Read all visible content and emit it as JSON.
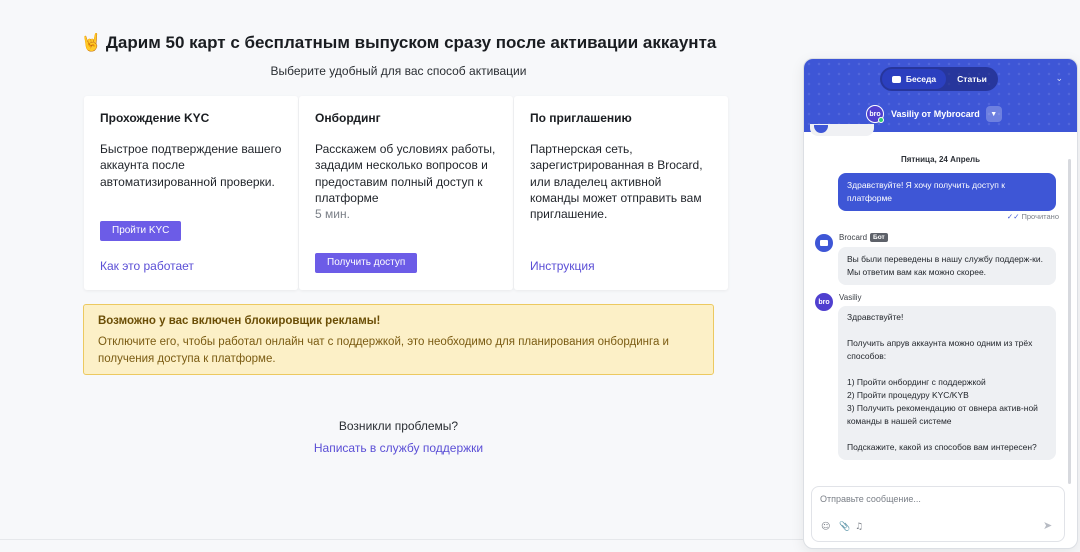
{
  "main": {
    "headline_emoji": "🤘",
    "headline": "Дарим 50 карт с бесплатным выпуском сразу после активации аккаунта",
    "subheadline": "Выберите удобный для вас способ активации",
    "cards": [
      {
        "title": "Прохождение KYC",
        "body": "Быстрое подтверждение вашего аккаунта после автоматизированной проверки.",
        "button": "Пройти KYC",
        "link": "Как это работает"
      },
      {
        "title": "Онбординг",
        "body": "Расскажем об условиях работы, зададим несколько вопросов и предоставим полный доступ к платформе",
        "body_muted": "5 мин.",
        "button": "Получить доступ"
      },
      {
        "title": "По приглашению",
        "body": "Партнерская сеть, зарегистрированная в Brocard, или владелец активной команды может отправить вам приглашение.",
        "link": "Инструкция"
      }
    ],
    "adblock": {
      "title": "Возможно у вас включен блокировщик рекламы!",
      "text": "Отключите его, чтобы работал онлайн чат с поддержкой, это необходимо для планирования онбординга и получения доступа к платформе."
    },
    "problems_label": "Возникли проблемы?",
    "support_link": "Написать в службу поддержки"
  },
  "chat": {
    "tabs": [
      "Беседа",
      "Статьи"
    ],
    "active_tab": 0,
    "agent_avatar": "bro",
    "agent_name": "Vasiliy от Mybrocard",
    "date_separator": "Пятница, 24 Апрель",
    "messages": [
      {
        "side": "out",
        "text": "Здравствуйте! Я хочу получить доступ к платформе",
        "status": "Прочитано"
      },
      {
        "side": "in",
        "sender": "Brocard",
        "badge": "Бот",
        "text": "Вы были переведены в нашу службу поддерж-ки. Мы ответим вам как можно скорее."
      },
      {
        "side": "in",
        "sender": "Vasiliy",
        "avatar": "bro",
        "lines": [
          "Здравствуйте!",
          "",
          "Получить апрув аккаунта можно одним из трёх способов:",
          "",
          "1) Пройти онбординг с поддержкой",
          "2) Пройти процедуру KYC/KYB",
          "3) Получить рекомендацию от овнера актив-ной команды в нашей системе",
          "",
          "Подскажите, какой из способов вам интересен?"
        ]
      }
    ],
    "composer_placeholder": "Отправьте сообщение...",
    "composer_value": "",
    "icons": [
      "emoji-icon",
      "attach-icon",
      "voice-icon",
      "send-icon"
    ]
  },
  "colors": {
    "accent": "#6c5ce7",
    "chat_header": "#3e56d6",
    "warning_bg": "#fcf0c7",
    "warning_border": "#ecc960"
  }
}
